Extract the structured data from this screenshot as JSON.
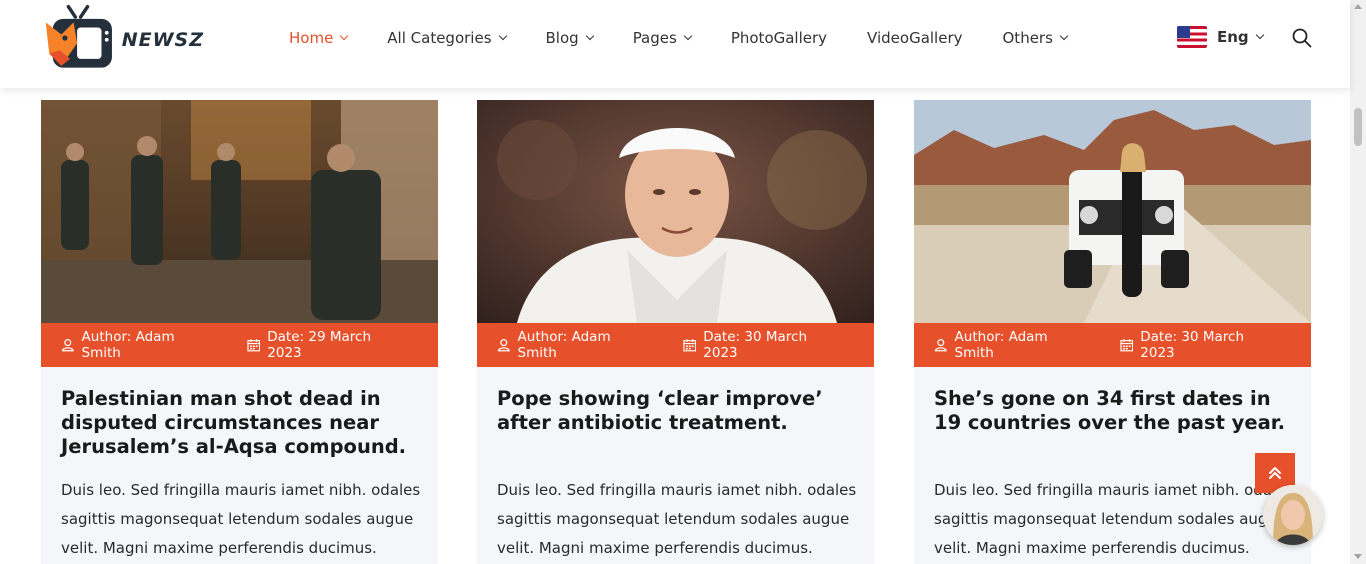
{
  "brand": {
    "name": "NEWSZ",
    "accent": "#e6502a",
    "dark": "#24303b"
  },
  "nav": {
    "items": [
      {
        "label": "Home",
        "has_dropdown": true,
        "active": true
      },
      {
        "label": "All Categories",
        "has_dropdown": true
      },
      {
        "label": "Blog",
        "has_dropdown": true
      },
      {
        "label": "Pages",
        "has_dropdown": true
      },
      {
        "label": "PhotoGallery",
        "has_dropdown": false
      },
      {
        "label": "VideoGallery",
        "has_dropdown": false
      },
      {
        "label": "Others",
        "has_dropdown": true
      }
    ],
    "language": {
      "label": "Eng",
      "flag": "us-flag-icon"
    },
    "search_icon": "search-icon"
  },
  "articles": [
    {
      "author": "Author: Adam Smith",
      "date": "Date: 29 March 2023",
      "title": "Palestinian man shot dead in disputed circumstances near Jerusalem’s al-Aqsa compound.",
      "excerpt": "Duis leo. Sed fringilla mauris iamet nibh. odales sagittis magonsequat letendum sodales augue velit. Magni maxime perferendis ducimus."
    },
    {
      "author": "Author: Adam Smith",
      "date": "Date: 30 March 2023",
      "title": "Pope showing ‘clear improve’ after antibiotic treatment.",
      "excerpt": "Duis leo. Sed fringilla mauris iamet nibh. odales sagittis magonsequat letendum sodales augue velit. Magni maxime perferendis ducimus."
    },
    {
      "author": "Author: Adam Smith",
      "date": "Date: 30 March 2023",
      "title": "She’s gone on 34 first dates in 19 countries over the past year.",
      "excerpt": "Duis leo. Sed fringilla mauris iamet nibh. odales sagittis magonsequat letendum sodales augue velit. Magni maxime perferendis ducimus."
    }
  ],
  "icons": {
    "author": "user-icon",
    "date": "calendar-icon",
    "back_to_top": "double-chevron-up-icon"
  }
}
